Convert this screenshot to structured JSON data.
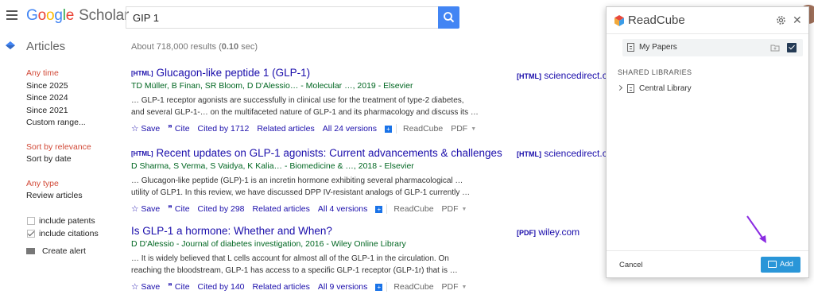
{
  "header": {
    "logo_google": [
      "G",
      "o",
      "o",
      "g",
      "l",
      "e"
    ],
    "logo_scholar": "Scholar",
    "search_value": "GIP 1"
  },
  "subheader": {
    "section_title": "Articles",
    "count_prefix": "About 718,000 results (",
    "count_time": "0.10",
    "count_suffix": " sec)"
  },
  "sidebar": {
    "time": [
      "Any time",
      "Since 2025",
      "Since 2024",
      "Since 2021",
      "Custom range..."
    ],
    "sort": [
      "Sort by relevance",
      "Sort by date"
    ],
    "type": [
      "Any type",
      "Review articles"
    ],
    "include_patents": "include patents",
    "include_citations": "include citations",
    "create_alert": "Create alert"
  },
  "results": [
    {
      "tag": "[HTML]",
      "title": "Glucagon-like peptide 1 (GLP-1)",
      "authors": "TD Müller, B Finan, SR Bloom, D D'Alessio… - Molecular …, 2019 - Elsevier",
      "snippet1": "… GLP-1 receptor agonists are successfully in clinical use for the treatment of type-2 diabetes,",
      "snippet2": "and several GLP-1-… on the multifaceted nature of GLP-1 and its pharmacology and discuss its …",
      "save": "Save",
      "cite": "Cite",
      "cited_by": "Cited by 1712",
      "related": "Related articles",
      "versions": "All 24 versions",
      "readcube": "ReadCube",
      "pdf": "PDF",
      "side_tag": "[HTML]",
      "side_source": "sciencedirect.c"
    },
    {
      "tag": "[HTML]",
      "title": "Recent updates on GLP-1 agonists: Current advancements & challenges",
      "authors": "D Sharma, S Verma, S Vaidya, K Kalia… - Biomedicine & …, 2018 - Elsevier",
      "snippet1": "… Glucagon-like peptide (GLP)-1 is an incretin hormone exhibiting several pharmacological …",
      "snippet2": "utility of GLP1. In this review, we have discussed DPP IV-resistant analogs of GLP-1 currently …",
      "save": "Save",
      "cite": "Cite",
      "cited_by": "Cited by 298",
      "related": "Related articles",
      "versions": "All 4 versions",
      "readcube": "ReadCube",
      "pdf": "PDF",
      "side_tag": "[HTML]",
      "side_source": "sciencedirect.c"
    },
    {
      "tag": "",
      "title": "Is GLP-1 a hormone: Whether and When?",
      "authors": "D D'Alessio - Journal of diabetes investigation, 2016 - Wiley Online Library",
      "snippet1": "… It is widely believed that L cells account for almost all of the GLP-1 in the circulation. On",
      "snippet2": "reaching the bloodstream, GLP-1 has access to a specific GLP-1 receptor (GLP-1r) that is …",
      "save": "Save",
      "cite": "Cite",
      "cited_by": "Cited by 140",
      "related": "Related articles",
      "versions": "All 9 versions",
      "readcube": "ReadCube",
      "pdf": "PDF",
      "side_tag": "[PDF]",
      "side_source": "wiley.com"
    }
  ],
  "readcube": {
    "title": "ReadCube",
    "my_papers": "My Papers",
    "my_papers_checked": true,
    "shared_header": "SHARED LIBRARIES",
    "central_library": "Central Library",
    "cancel": "Cancel",
    "add": "Add",
    "colors": {
      "add_button": "#2a96d8",
      "checkbox": "#253b56",
      "arrow": "#8a2be2"
    }
  }
}
